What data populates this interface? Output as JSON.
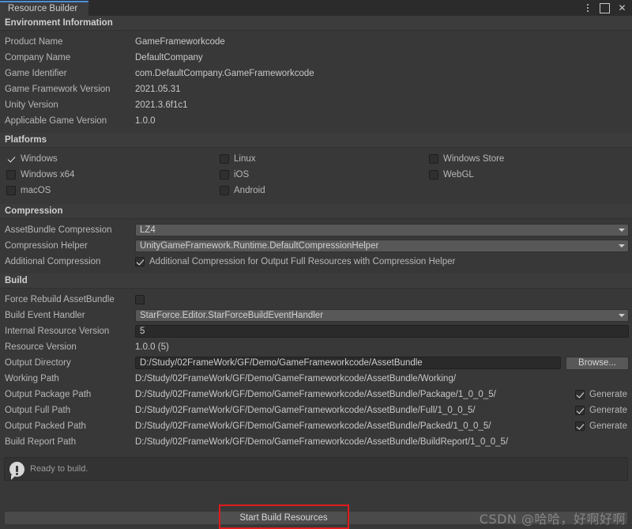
{
  "colors": {
    "accent": "#4a90d9",
    "highlight": "#e01b1b",
    "panel_bg": "#383838",
    "header_bg": "#3c3c3c"
  },
  "window": {
    "tab_label": "Resource Builder",
    "menu_icon": "kebab-menu-icon",
    "maximize_icon": "maximize-icon",
    "close_icon": "close-icon",
    "close_glyph": "✕"
  },
  "environment": {
    "title": "Environment Information",
    "rows": [
      {
        "label": "Product Name",
        "value": "GameFrameworkcode"
      },
      {
        "label": "Company Name",
        "value": "DefaultCompany"
      },
      {
        "label": "Game Identifier",
        "value": "com.DefaultCompany.GameFrameworkcode"
      },
      {
        "label": "Game Framework Version",
        "value": "2021.05.31"
      },
      {
        "label": "Unity Version",
        "value": "2021.3.6f1c1"
      },
      {
        "label": "Applicable Game Version",
        "value": "1.0.0"
      }
    ]
  },
  "platforms": {
    "title": "Platforms",
    "items": [
      {
        "label": "Windows",
        "checked": true
      },
      {
        "label": "Linux",
        "checked": false
      },
      {
        "label": "Windows Store",
        "checked": false
      },
      {
        "label": "Windows x64",
        "checked": false
      },
      {
        "label": "iOS",
        "checked": false
      },
      {
        "label": "WebGL",
        "checked": false
      },
      {
        "label": "macOS",
        "checked": false
      },
      {
        "label": "Android",
        "checked": false
      },
      {
        "label": "",
        "checked": false
      }
    ]
  },
  "compression": {
    "title": "Compression",
    "assetbundle_label": "AssetBundle Compression",
    "assetbundle_value": "LZ4",
    "helper_label": "Compression Helper",
    "helper_value": "UnityGameFramework.Runtime.DefaultCompressionHelper",
    "additional_label": "Additional Compression",
    "additional_caption": "Additional Compression for Output Full Resources with Compression Helper",
    "additional_checked": true
  },
  "build": {
    "title": "Build",
    "force_rebuild_label": "Force Rebuild AssetBundle",
    "force_rebuild_checked": false,
    "event_handler_label": "Build Event Handler",
    "event_handler_value": "StarForce.Editor.StarForceBuildEventHandler",
    "internal_version_label": "Internal Resource Version",
    "internal_version_value": "5",
    "resource_version_label": "Resource Version",
    "resource_version_value": "1.0.0 (5)",
    "output_dir_label": "Output Directory",
    "output_dir_value": "D:/Study/02FrameWork/GF/Demo/GameFrameworkcode/AssetBundle",
    "browse_label": "Browse...",
    "generate_label": "Generate",
    "paths": [
      {
        "label": "Working Path",
        "value": "D:/Study/02FrameWork/GF/Demo/GameFrameworkcode/AssetBundle/Working/",
        "generate": null
      },
      {
        "label": "Output Package Path",
        "value": "D:/Study/02FrameWork/GF/Demo/GameFrameworkcode/AssetBundle/Package/1_0_0_5/",
        "generate": true
      },
      {
        "label": "Output Full Path",
        "value": "D:/Study/02FrameWork/GF/Demo/GameFrameworkcode/AssetBundle/Full/1_0_0_5/",
        "generate": true
      },
      {
        "label": "Output Packed Path",
        "value": "D:/Study/02FrameWork/GF/Demo/GameFrameworkcode/AssetBundle/Packed/1_0_0_5/",
        "generate": true
      },
      {
        "label": "Build Report Path",
        "value": "D:/Study/02FrameWork/GF/Demo/GameFrameworkcode/AssetBundle/BuildReport/1_0_0_5/",
        "generate": null
      }
    ]
  },
  "status": {
    "icon": "info-bubble-icon",
    "text": "Ready to build."
  },
  "footer": {
    "build_button_label": "Start Build Resources",
    "watermark": "CSDN @哈哈，好啊好啊"
  }
}
